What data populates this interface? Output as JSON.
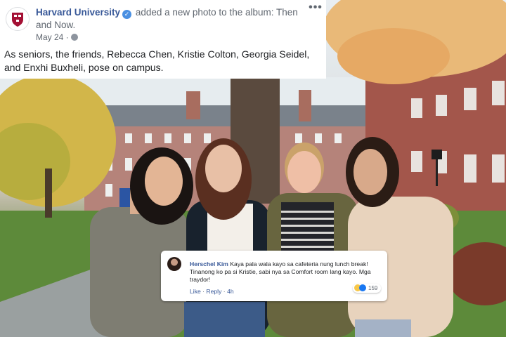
{
  "post": {
    "page_name": "Harvard University",
    "action_text": "added a new photo to the album: Then and Now.",
    "date": "May 24 ·",
    "more_icon": "more-icon",
    "caption": "As seniors, the friends, Rebecca Chen, Kristie Colton, Georgia Seidel, and Enxhi Buxheli, pose on campus."
  },
  "comment": {
    "author": "Herschel Kim",
    "text": "Kaya pala wala kayo sa cafeteria nung lunch break! Tinanong ko pa si Kristie, sabi nya sa Comfort room lang kayo. Mga traydor!",
    "like_label": "Like",
    "separator": "·",
    "reply_label": "Reply",
    "time": "4h",
    "reaction_count": "159"
  },
  "colors": {
    "link": "#385898",
    "harvard_crimson": "#a41034"
  }
}
